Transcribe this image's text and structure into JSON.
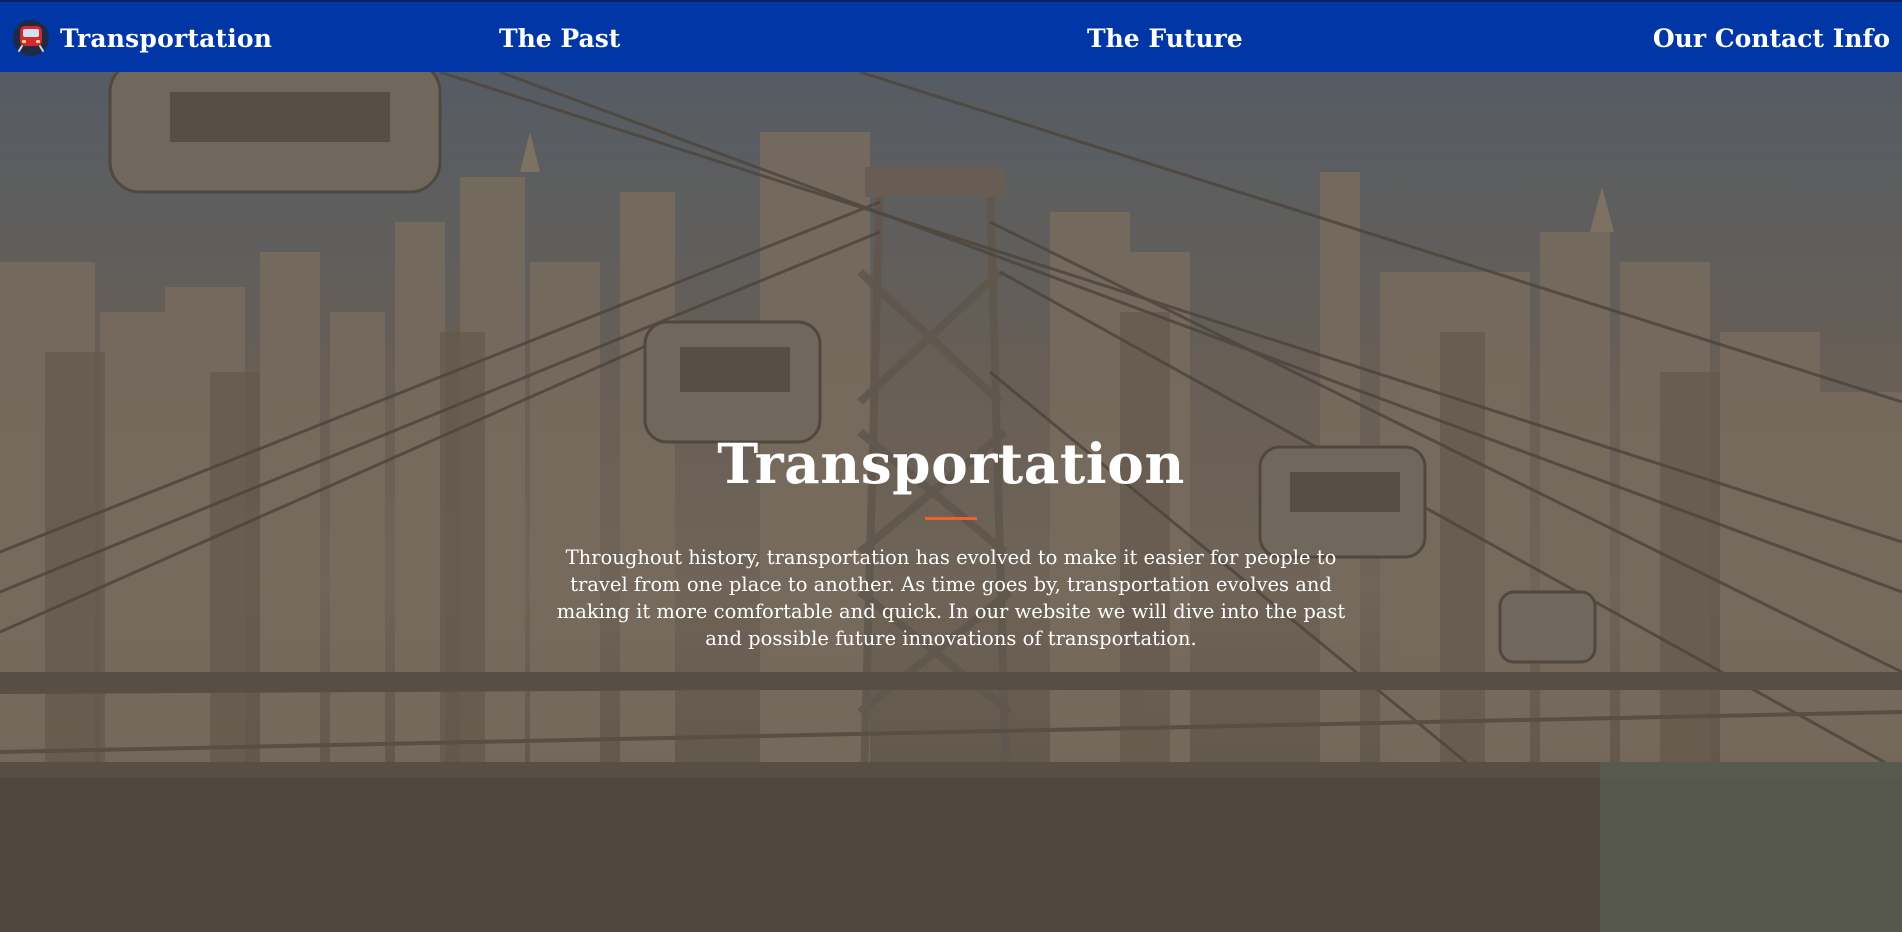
{
  "navbar": {
    "brand": {
      "label": "Transportation",
      "icon": "train-icon"
    },
    "links": [
      {
        "label": "The Past"
      },
      {
        "label": "The Future"
      },
      {
        "label": "Our Contact Info"
      }
    ],
    "color": "#0036a6"
  },
  "hero": {
    "title": "Transportation",
    "divider_color": "#f05f2d",
    "description": "Throughout history, transportation has evolved to make it easier for people to travel from one place to another. As time goes by, transportation evolves and making it more comfortable and quick. In our website we will dive into the past and possible future innovations of transportation.",
    "background_image": "city-skyline-cable-car"
  }
}
